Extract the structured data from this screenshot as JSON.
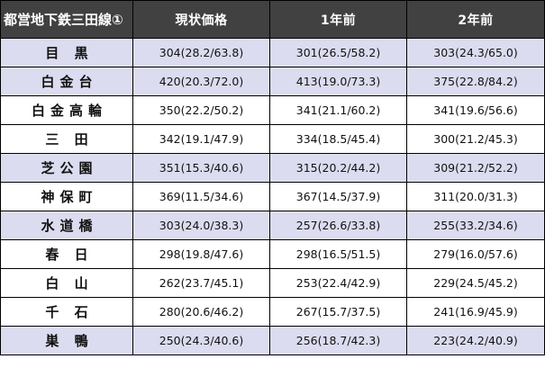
{
  "table": {
    "headers": {
      "line": "都営地下鉄三田線①",
      "current": "現状価格",
      "one_year": "1年前",
      "two_year": "2年前"
    },
    "rows": [
      {
        "station": "目 黒",
        "current": "304(28.2/63.8)",
        "one_year": "301(26.5/58.2)",
        "two_year": "303(24.3/65.0)",
        "shaded": true
      },
      {
        "station": "白金台",
        "current": "420(20.3/72.0)",
        "one_year": "413(19.0/73.3)",
        "two_year": "375(22.8/84.2)",
        "shaded": true
      },
      {
        "station": "白金高輪",
        "current": "350(22.2/50.2)",
        "one_year": "341(21.1/60.2)",
        "two_year": "341(19.6/56.6)",
        "shaded": false
      },
      {
        "station": "三 田",
        "current": "342(19.1/47.9)",
        "one_year": "334(18.5/45.4)",
        "two_year": "300(21.2/45.3)",
        "shaded": false
      },
      {
        "station": "芝公園",
        "current": "351(15.3/40.6)",
        "one_year": "315(20.2/44.2)",
        "two_year": "309(21.2/52.2)",
        "shaded": true
      },
      {
        "station": "神保町",
        "current": "369(11.5/34.6)",
        "one_year": "367(14.5/37.9)",
        "two_year": "311(20.0/31.3)",
        "shaded": false
      },
      {
        "station": "水道橋",
        "current": "303(24.0/38.3)",
        "one_year": "257(26.6/33.8)",
        "two_year": "255(33.2/34.6)",
        "shaded": true
      },
      {
        "station": "春 日",
        "current": "298(19.8/47.6)",
        "one_year": "298(16.5/51.5)",
        "two_year": "279(16.0/57.6)",
        "shaded": false
      },
      {
        "station": "白 山",
        "current": "262(23.7/45.1)",
        "one_year": "253(22.4/42.9)",
        "two_year": "229(24.5/45.2)",
        "shaded": false
      },
      {
        "station": "千 石",
        "current": "280(20.6/46.2)",
        "one_year": "267(15.7/37.5)",
        "two_year": "241(16.9/45.9)",
        "shaded": false
      },
      {
        "station": "巣 鴨",
        "current": "250(24.3/40.6)",
        "one_year": "256(18.7/42.3)",
        "two_year": "223(24.2/40.9)",
        "shaded": true
      }
    ]
  }
}
